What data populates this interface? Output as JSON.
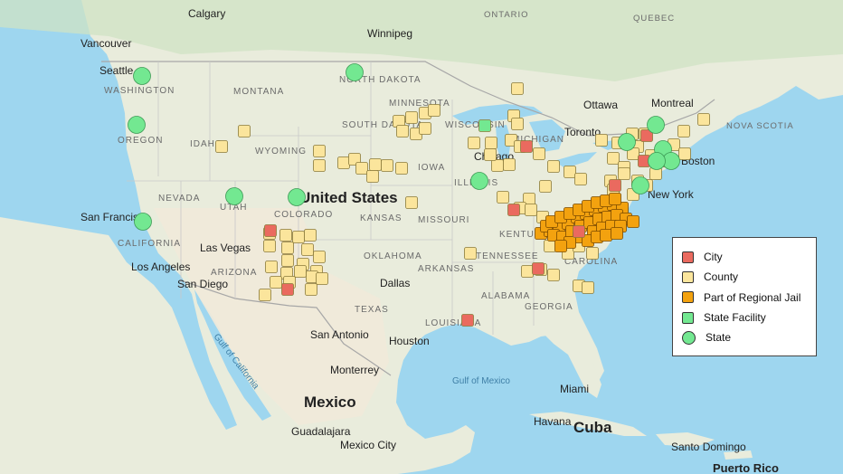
{
  "map": {
    "colors": {
      "water": "#9ed6ef",
      "land": "#e9ecdc",
      "forest": "#cfe3c4",
      "desert": "#f1ead9",
      "border": "#a7a7a7"
    },
    "labels": {
      "countries": [
        "United States",
        "Mexico",
        "Cuba"
      ],
      "states": [
        "WASHINGTON",
        "OREGON",
        "CALIFORNIA",
        "NEVADA",
        "IDAHO",
        "MONTANA",
        "WYOMING",
        "UTAH",
        "COLORADO",
        "ARIZONA",
        "NORTH DAKOTA",
        "SOUTH DAKOTA",
        "MINNESOTA",
        "IOWA",
        "KANSAS",
        "OKLAHOMA",
        "TEXAS",
        "MISSOURI",
        "ARKANSAS",
        "LOUISIANA",
        "TENNESSEE",
        "KENTUCKY",
        "ALABAMA",
        "GEORGIA",
        "CAROLINA",
        "WISCONSIN",
        "MICHIGAN",
        "ILLINOIS",
        "ONTARIO",
        "QUEBEC",
        "NOVA SCOTIA"
      ],
      "cities": [
        "Calgary",
        "Vancouver",
        "Seattle",
        "Winnipeg",
        "Ottawa",
        "Montreal",
        "Toronto",
        "Boston",
        "New York",
        "Chicago",
        "San Francisco",
        "Las Vegas",
        "Los Angeles",
        "San Diego",
        "Dallas",
        "San Antonio",
        "Houston",
        "Monterrey",
        "Guadalajara",
        "Mexico City",
        "Miami",
        "Havana",
        "Santo Domingo",
        "Puerto Rico"
      ],
      "water": [
        "Gulf of California",
        "Gulf of Mexico"
      ]
    },
    "legend": [
      {
        "label": "City",
        "color": "#ea6a5f",
        "shape": "square"
      },
      {
        "label": "County",
        "color": "#fbe59c",
        "shape": "square"
      },
      {
        "label": "Part of Regional Jail",
        "color": "#f3a20f",
        "shape": "square"
      },
      {
        "label": "State Facility",
        "color": "#73e891",
        "shape": "square"
      },
      {
        "label": "State",
        "color": "#73e891",
        "shape": "circle"
      }
    ]
  }
}
